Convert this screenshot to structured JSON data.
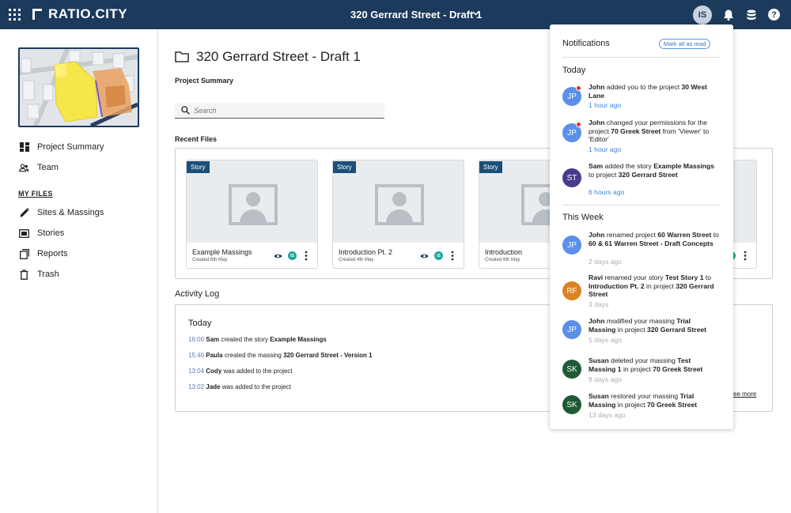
{
  "app": {
    "logo": "RATIO.CITY",
    "project_title": "320 Gerrard Street - Draft 1",
    "user_initials": "IS"
  },
  "sidebar": {
    "items": [
      {
        "label": "Project Summary",
        "icon": "dashboard-icon"
      },
      {
        "label": "Team",
        "icon": "people-icon"
      }
    ],
    "section_label": "MY FILES",
    "files_items": [
      {
        "label": "Sites & Massings",
        "icon": "pencil-icon"
      },
      {
        "label": "Stories",
        "icon": "stories-icon"
      },
      {
        "label": "Reports",
        "icon": "copy-icon"
      },
      {
        "label": "Trash",
        "icon": "trash-icon"
      }
    ]
  },
  "main": {
    "title": "320 Gerrard Street - Draft 1",
    "subtitle": "Project Summary",
    "search_placeholder": "Search",
    "recent_files_label": "Recent Files",
    "files": [
      {
        "tag": "Story",
        "name": "Example Massings",
        "created": "Created 6th May",
        "badge": "IS"
      },
      {
        "tag": "Story",
        "name": "Introduction Pt. 2",
        "created": "Created 4th May",
        "badge": "IS"
      },
      {
        "tag": "Story",
        "name": "Introduction",
        "created": "Created 6th May",
        "badge": "IS"
      }
    ],
    "activity": {
      "title": "Activity Log",
      "today": "Today",
      "rows": [
        {
          "time": "16:00",
          "who": "Sam",
          "text": " created the story ",
          "obj": "Example Massings"
        },
        {
          "time": "15:40",
          "who": "Paula",
          "text": " created the massing ",
          "obj": "320 Gerrard Street - Version 1"
        },
        {
          "time": "13:04",
          "who": "Cody",
          "text": " was added to the project",
          "obj": ""
        },
        {
          "time": "13:02",
          "who": "Jade",
          "text": " was added to the project",
          "obj": ""
        }
      ],
      "see_more": "ee more"
    }
  },
  "notifications": {
    "title": "Notifications",
    "mark_all": "Mark all as read",
    "today_label": "Today",
    "week_label": "This Week",
    "colors": {
      "jp": "#5b8fe8",
      "st": "#4a3a8c",
      "rf": "#d98324",
      "sk": "#1e5a34",
      "time_new": "#3b86d6",
      "time_old": "#a8adb3"
    },
    "items": [
      {
        "initials": "JP",
        "unread": true,
        "segments": [
          [
            "b",
            "John"
          ],
          [
            "n",
            " added you to the project "
          ],
          [
            "b",
            "30 West Lane"
          ]
        ],
        "time": "1 hour ago"
      },
      {
        "initials": "JP",
        "unread": true,
        "segments": [
          [
            "b",
            "John"
          ],
          [
            "n",
            " changed your permissions for the project "
          ],
          [
            "b",
            "70 Greek Street"
          ],
          [
            "n",
            " from 'Viewer' to 'Editor'"
          ]
        ],
        "time": "1 hour ago"
      },
      {
        "initials": "ST",
        "unread": false,
        "segments": [
          [
            "b",
            "Sam"
          ],
          [
            "n",
            " added the story "
          ],
          [
            "b",
            "Example Massings"
          ],
          [
            "n",
            " to project "
          ],
          [
            "b",
            "320 Gerrard Street"
          ]
        ],
        "time": "6 hours ago"
      },
      {
        "initials": "JP",
        "unread": false,
        "segments": [
          [
            "b",
            "John"
          ],
          [
            "n",
            " renamed project "
          ],
          [
            "b",
            "60 Warren Street"
          ],
          [
            "n",
            " to "
          ],
          [
            "b",
            "60 & 61 Warren Street - Draft Concepts"
          ]
        ],
        "time": "2 days ago"
      },
      {
        "initials": "RF",
        "unread": false,
        "segments": [
          [
            "b",
            "Ravi"
          ],
          [
            "n",
            " renamed your story "
          ],
          [
            "b",
            "Test Story 1"
          ],
          [
            "n",
            " to "
          ],
          [
            "b",
            "Introduction Pt. 2"
          ],
          [
            "n",
            " in project "
          ],
          [
            "b",
            "320 Gerrard Street"
          ]
        ],
        "time": "3 days"
      },
      {
        "initials": "JP",
        "unread": false,
        "segments": [
          [
            "b",
            "John"
          ],
          [
            "n",
            " modified your massing "
          ],
          [
            "b",
            "Trial Massing"
          ],
          [
            "n",
            " in project "
          ],
          [
            "b",
            "320 Gerrard Street"
          ]
        ],
        "time": "5 days ago"
      },
      {
        "initials": "SK",
        "unread": false,
        "segments": [
          [
            "b",
            "Susan"
          ],
          [
            "n",
            " deleted your massing "
          ],
          [
            "b",
            "Test Massing 1"
          ],
          [
            "n",
            " in project "
          ],
          [
            "b",
            "70 Greek Street"
          ]
        ],
        "time": "8 days ago"
      },
      {
        "initials": "SK",
        "unread": false,
        "segments": [
          [
            "b",
            "Susan"
          ],
          [
            "n",
            " restored your massing "
          ],
          [
            "b",
            "Trial Massing"
          ],
          [
            "n",
            " in project "
          ],
          [
            "b",
            "70 Greek Street"
          ]
        ],
        "time": "13 days ago"
      }
    ]
  }
}
